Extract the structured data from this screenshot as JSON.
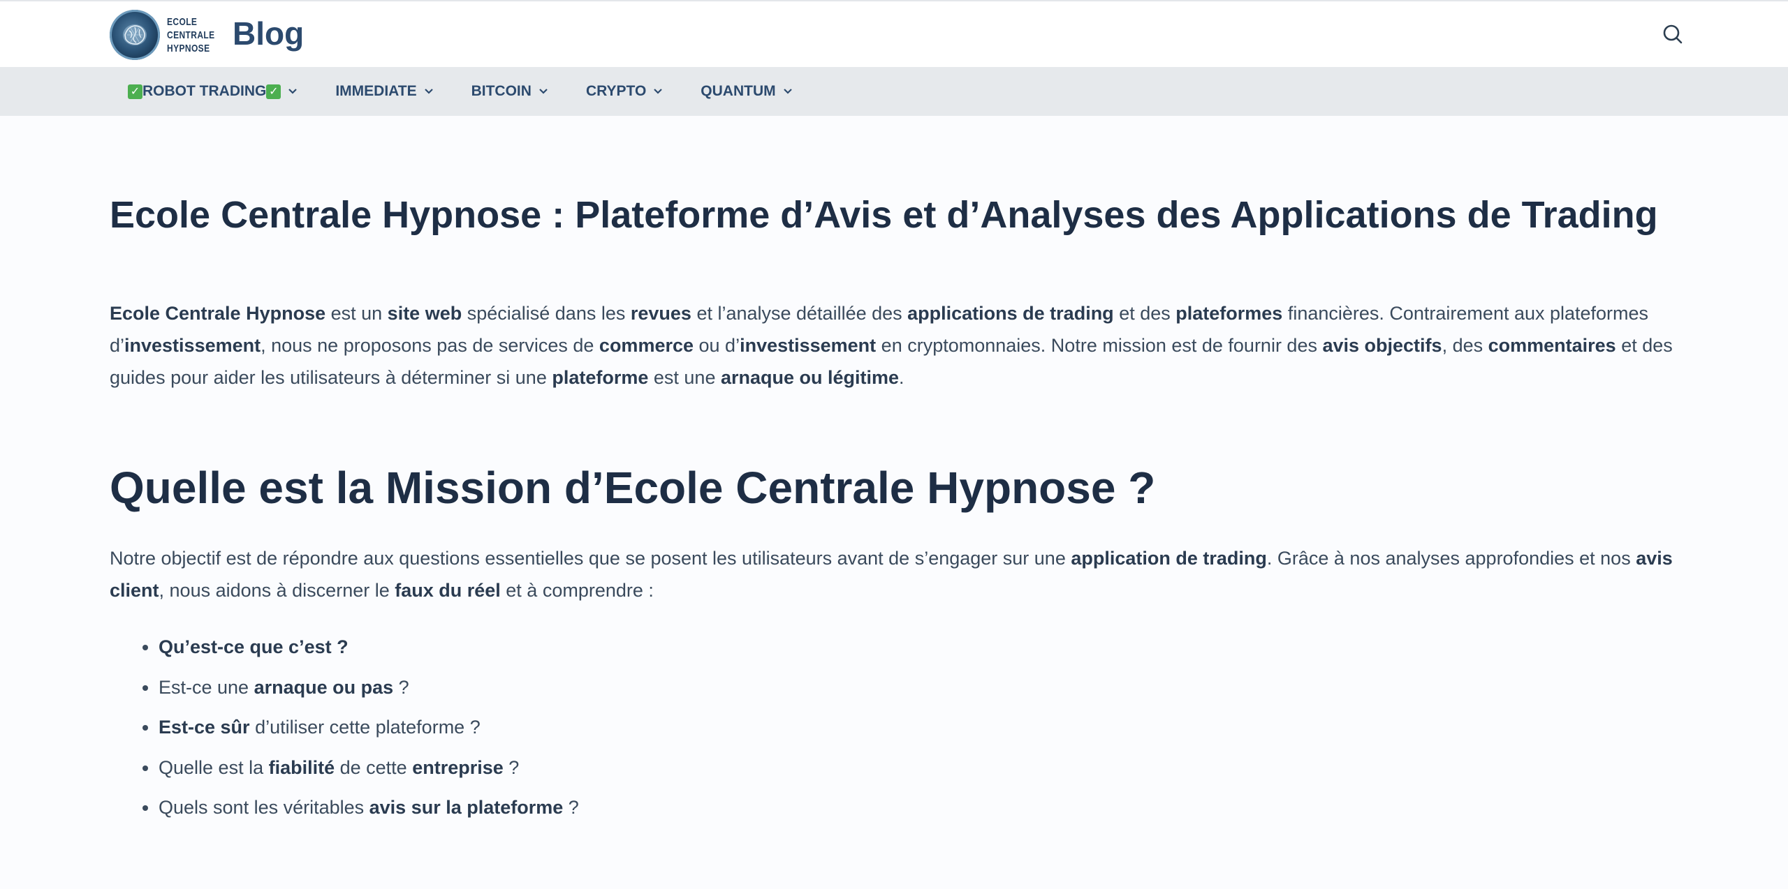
{
  "header": {
    "logo_line1": "ECOLE",
    "logo_line2": "CENTRALE",
    "logo_line3": "HYPNOSE",
    "blog_title": "Blog"
  },
  "nav": {
    "items": [
      {
        "label": "ROBOT TRADING"
      },
      {
        "label": "IMMEDIATE"
      },
      {
        "label": "BITCOIN"
      },
      {
        "label": "CRYPTO"
      },
      {
        "label": "QUANTUM"
      }
    ]
  },
  "article": {
    "title": "Ecole Centrale Hypnose : Plateforme d’Avis et d’Analyses des Applications de Trading",
    "intro": {
      "p1": "Ecole Centrale Hypnose",
      "p2": " est un ",
      "p3": "site web",
      "p4": " spécialisé dans les ",
      "p5": "revues",
      "p6": " et l’analyse détaillée des ",
      "p7": "applications de trading",
      "p8": " et des ",
      "p9": "plateformes",
      "p10": " financières. Contrairement aux plateformes d’",
      "p11": "investissement",
      "p12": ", nous ne proposons pas de services de ",
      "p13": "commerce",
      "p14": " ou d’",
      "p15": "investissement",
      "p16": " en cryptomonnaies. Notre mission est de fournir des ",
      "p17": "avis objectifs",
      "p18": ", des ",
      "p19": "commentaires",
      "p20": " et des guides pour aider les utilisateurs à déterminer si une ",
      "p21": "plateforme",
      "p22": " est une ",
      "p23": "arnaque ou légitime",
      "p24": "."
    },
    "section_title": "Quelle est la Mission d’Ecole Centrale Hypnose ?",
    "mission": {
      "p1": "Notre objectif est de répondre aux questions essentielles que se posent les utilisateurs avant de s’engager sur une ",
      "p2": "application de trading",
      "p3": ". Grâce à nos analyses approfondies et nos ",
      "p4": "avis client",
      "p5": ", nous aidons à discerner le ",
      "p6": "faux du réel",
      "p7": " et à comprendre :"
    },
    "questions": {
      "q1_bold": "Qu’est-ce que c’est ?",
      "q2_a": "Est-ce une ",
      "q2_b": "arnaque ou pas",
      "q2_c": " ?",
      "q3_b": "Est-ce sûr",
      "q3_c": " d’utiliser cette plateforme ?",
      "q4_a": "Quelle est la ",
      "q4_b": "fiabilité",
      "q4_c": " de cette ",
      "q4_d": "entreprise",
      "q4_e": " ?",
      "q5_a": "Quels sont les véritables ",
      "q5_b": "avis sur la plateforme",
      "q5_c": " ?"
    }
  }
}
